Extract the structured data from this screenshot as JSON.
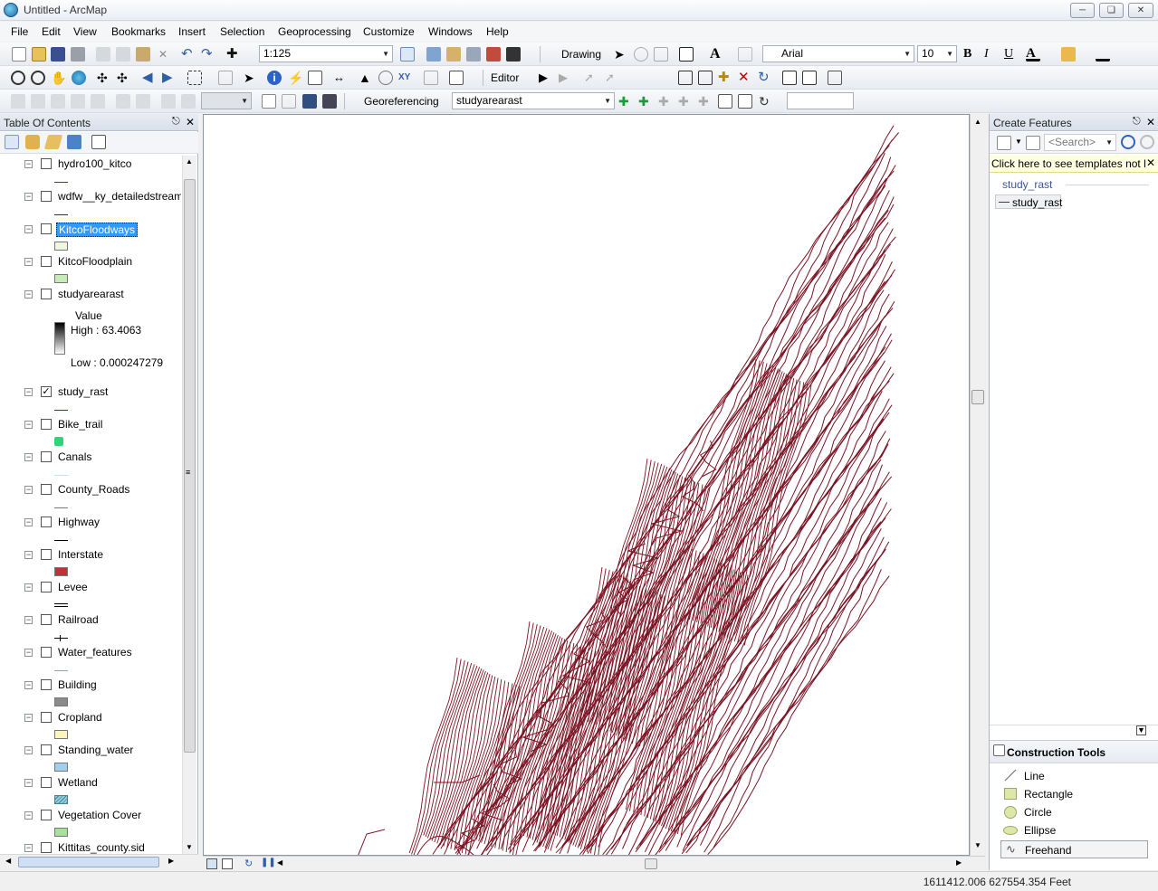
{
  "window": {
    "title": "Untitled - ArcMap"
  },
  "menu": [
    "File",
    "Edit",
    "View",
    "Bookmarks",
    "Insert",
    "Selection",
    "Geoprocessing",
    "Customize",
    "Windows",
    "Help"
  ],
  "toolbar": {
    "scale": "1:125",
    "drawing_label": "Drawing",
    "font_name": "Arial",
    "font_size": "10",
    "editor_label": "Editor",
    "georef_label": "Georeferencing",
    "georef_layer": "studyarearast",
    "bold": "B",
    "italic": "I",
    "underline": "U"
  },
  "toc": {
    "title": "Table Of Contents",
    "layers": [
      {
        "name": "hydro100_kitco",
        "checked": false,
        "symbol": "line",
        "color": "#8b2a2a"
      },
      {
        "name": "wdfw__ky_detailedstream",
        "checked": false,
        "symbol": "line",
        "color": "#333333"
      },
      {
        "name": "KitcoFloodways",
        "checked": false,
        "symbol": "fill",
        "color": "#eef8e0",
        "selected": true
      },
      {
        "name": "KitcoFloodplain",
        "checked": false,
        "symbol": "fill",
        "color": "#c8ecb8"
      },
      {
        "name": "studyarearast",
        "checked": false,
        "symbol": "raster"
      },
      {
        "name": "study_rast",
        "checked": true,
        "symbol": "line",
        "color": "#8b1a2a"
      },
      {
        "name": "Bike_trail",
        "checked": false,
        "symbol": "bike",
        "color": "#35d07a"
      },
      {
        "name": "Canals",
        "checked": false,
        "symbol": "line",
        "color": "#b8e8f0"
      },
      {
        "name": "County_Roads",
        "checked": false,
        "symbol": "line",
        "color": "#777777"
      },
      {
        "name": "Highway",
        "checked": false,
        "symbol": "line",
        "color": "#000000"
      },
      {
        "name": "Interstate",
        "checked": false,
        "symbol": "fill",
        "color": "#c0303a"
      },
      {
        "name": "Levee",
        "checked": false,
        "symbol": "double",
        "color": "#000000"
      },
      {
        "name": "Railroad",
        "checked": false,
        "symbol": "rail",
        "color": "#000000"
      },
      {
        "name": "Water_features",
        "checked": false,
        "symbol": "line",
        "color": "#5fb6d6"
      },
      {
        "name": "Building",
        "checked": false,
        "symbol": "fill",
        "color": "#8a8a8a"
      },
      {
        "name": "Cropland",
        "checked": false,
        "symbol": "fill",
        "color": "#fdf5c0"
      },
      {
        "name": "Standing_water",
        "checked": false,
        "symbol": "fill",
        "color": "#9fd0f0"
      },
      {
        "name": "Wetland",
        "checked": false,
        "symbol": "hatch",
        "color": "#8fd0e0"
      },
      {
        "name": "Vegetation Cover",
        "checked": false,
        "symbol": "fill",
        "color": "#a6e09a"
      },
      {
        "name": "Kittitas_county.sid",
        "checked": false,
        "symbol": "none"
      }
    ],
    "raster_legend": {
      "label": "Value",
      "high": "High : 63.4063",
      "low": "Low : 0.000247279"
    }
  },
  "create_features": {
    "title": "Create Features",
    "search_placeholder": "<Search>",
    "notice": "Click here to see templates not l",
    "group": "study_rast",
    "template": "study_rast",
    "construction_title": "Construction Tools",
    "tools": [
      "Line",
      "Rectangle",
      "Circle",
      "Ellipse",
      "Freehand"
    ]
  },
  "status": {
    "coords": "1611412.006  627554.354 Feet"
  },
  "colors": {
    "contour": "#7a1424",
    "selection": "#3399ff"
  }
}
